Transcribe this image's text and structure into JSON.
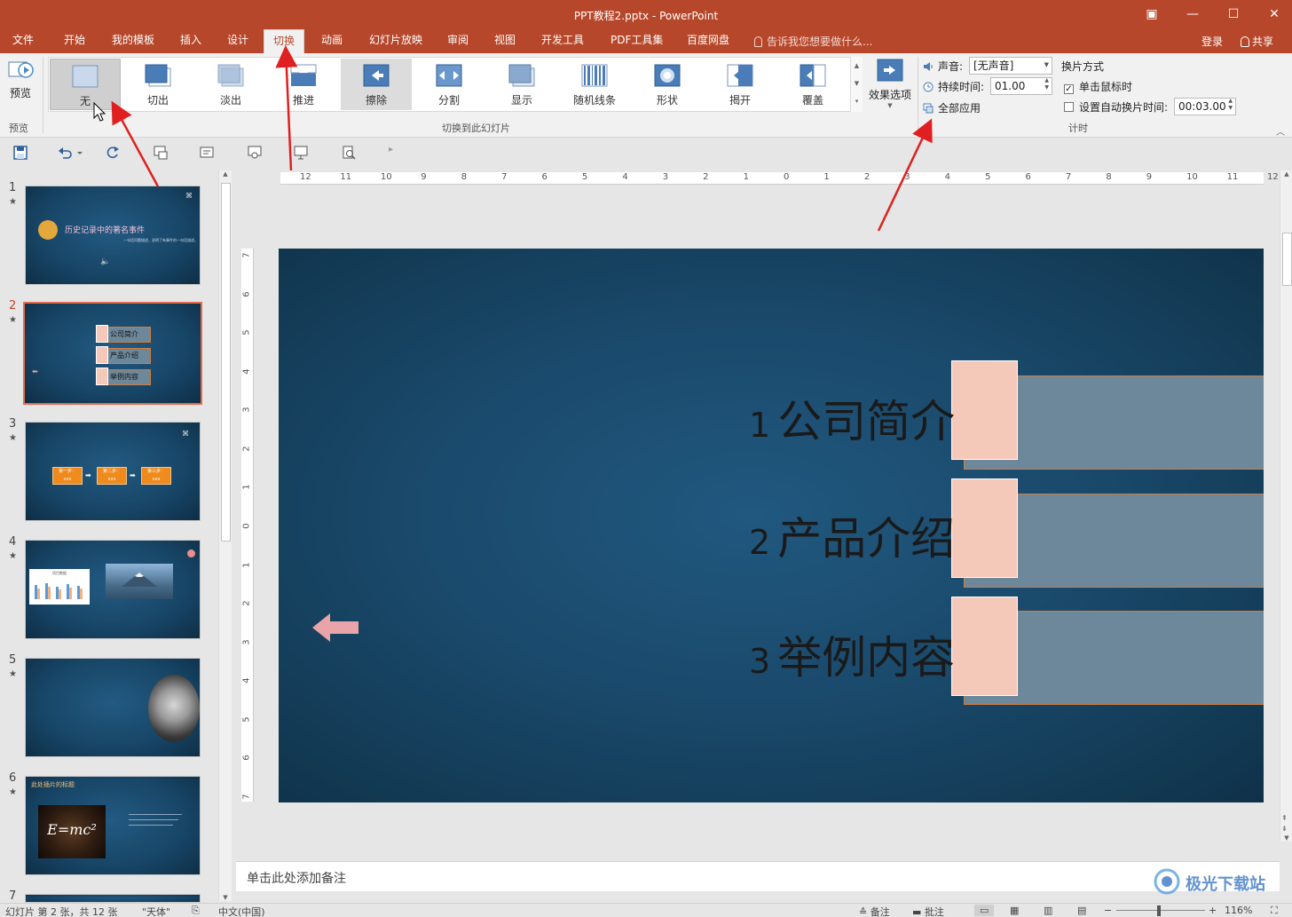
{
  "app": {
    "title": "PPT教程2.pptx - PowerPoint",
    "window_controls": [
      "ribbon-display-icon",
      "minimize-icon",
      "maximize-icon",
      "close-icon"
    ]
  },
  "menu": {
    "tabs": [
      "文件",
      "开始",
      "我的模板",
      "插入",
      "设计",
      "切换",
      "动画",
      "幻灯片放映",
      "审阅",
      "视图",
      "开发工具",
      "PDF工具集",
      "百度网盘"
    ],
    "active_tab": "切换",
    "tell_me": "告诉我您想要做什么...",
    "login": "登录",
    "share": "共享"
  },
  "ribbon": {
    "preview": {
      "label": "预览",
      "group": "预览"
    },
    "transitions": [
      {
        "label": "无",
        "icon": "none-transition-icon",
        "selected": true
      },
      {
        "label": "切出",
        "icon": "cut-transition-icon",
        "selected": false
      },
      {
        "label": "淡出",
        "icon": "fade-transition-icon",
        "selected": false
      },
      {
        "label": "推进",
        "icon": "push-transition-icon",
        "selected": false
      },
      {
        "label": "擦除",
        "icon": "wipe-transition-icon",
        "selected": false
      },
      {
        "label": "分割",
        "icon": "split-transition-icon",
        "selected": false
      },
      {
        "label": "显示",
        "icon": "reveal-transition-icon",
        "selected": false
      },
      {
        "label": "随机线条",
        "icon": "random-bars-transition-icon",
        "selected": false
      },
      {
        "label": "形状",
        "icon": "shape-transition-icon",
        "selected": false
      },
      {
        "label": "揭开",
        "icon": "uncover-transition-icon",
        "selected": false
      },
      {
        "label": "覆盖",
        "icon": "cover-transition-icon",
        "selected": false
      }
    ],
    "effect_options": "效果选项",
    "transitions_group": "切换到此幻灯片",
    "timing": {
      "sound_label": "声音:",
      "sound_value": "[无声音]",
      "duration_label": "持续时间:",
      "duration_value": "01.00",
      "apply_all": "全部应用",
      "advance_label": "换片方式",
      "on_click_label": "单击鼠标时",
      "on_click_checked": true,
      "after_label": "设置自动换片时间:",
      "after_checked": false,
      "after_value": "00:03.00",
      "group": "计时"
    }
  },
  "thumbnails": [
    {
      "num": "1",
      "title": "历史记录中的著名事件",
      "subtitle": "一句话问题描述，说明了有事件的一句话描述。"
    },
    {
      "num": "2",
      "items": [
        "公司简介",
        "产品介绍",
        "举例内容"
      ]
    },
    {
      "num": "3",
      "steps": [
        "第一步：",
        "第二步：",
        "第三步："
      ],
      "sub": "xxx"
    },
    {
      "num": "4",
      "chart_title": "项目数据"
    },
    {
      "num": "5"
    },
    {
      "num": "6",
      "title": "此处插片的标题",
      "formula": "E=mc²"
    },
    {
      "num": "7"
    }
  ],
  "current_slide": {
    "items": [
      {
        "num": "1",
        "text": "公司简介"
      },
      {
        "num": "2",
        "text": "产品介绍"
      },
      {
        "num": "3",
        "text": "举例内容"
      }
    ]
  },
  "notes_placeholder": "单击此处添加备注",
  "ruler": {
    "h": [
      "12",
      "11",
      "10",
      "9",
      "8",
      "7",
      "6",
      "5",
      "4",
      "3",
      "2",
      "1",
      "0",
      "1",
      "2",
      "3",
      "4",
      "5",
      "6",
      "7",
      "8",
      "9",
      "10",
      "11",
      "12"
    ],
    "v": [
      "7",
      "6",
      "5",
      "4",
      "3",
      "2",
      "1",
      "0",
      "1",
      "2",
      "3",
      "4",
      "5",
      "6",
      "7"
    ]
  },
  "status": {
    "slide_info": "幻灯片 第 2 张，共 12 张",
    "theme": "\"天体\"",
    "language": "中文(中国)",
    "notes": "备注",
    "comments": "批注",
    "zoom": "116%"
  },
  "watermark": "极光下载站",
  "colors": {
    "accent": "#b7472a",
    "slide_bg": "#1a4a6c",
    "item_box": "#6d889b",
    "item_square": "#f5c9b9",
    "arrow_annotation": "#e02020"
  }
}
